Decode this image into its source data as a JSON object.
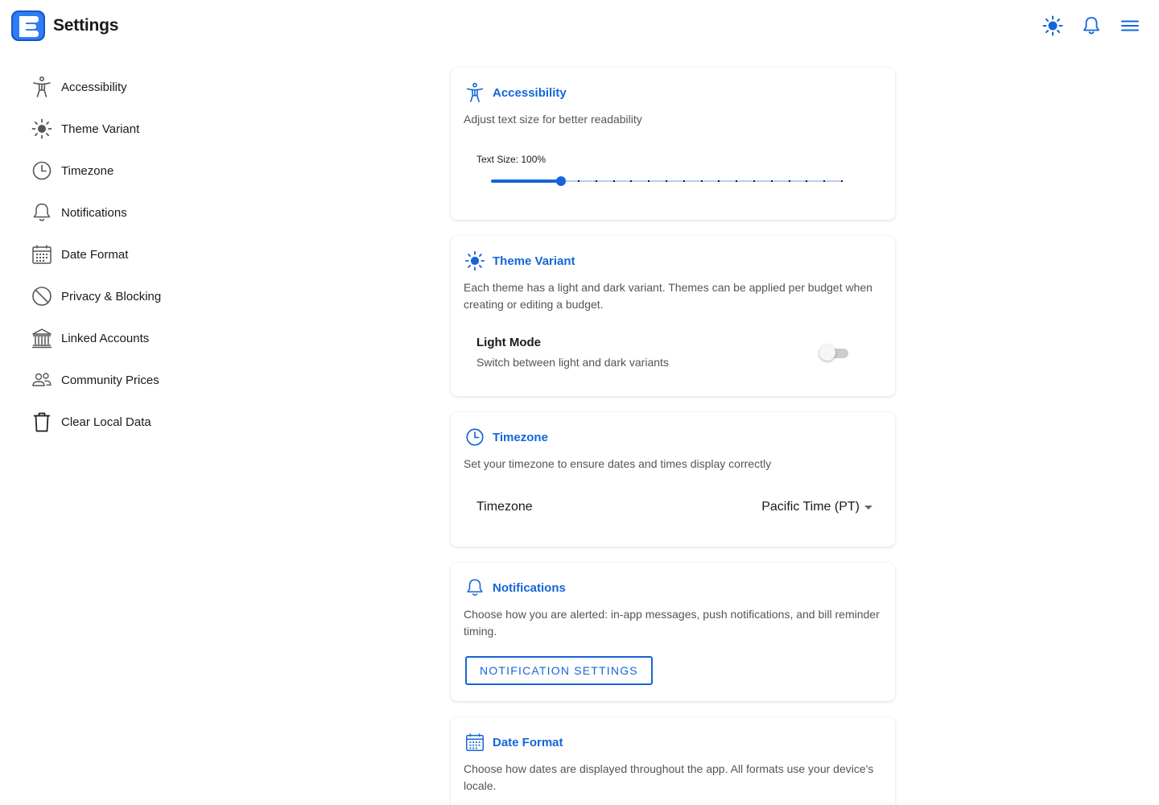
{
  "header": {
    "title": "Settings",
    "logo_letter": "E",
    "icons": [
      "sun-icon",
      "bell-icon",
      "menu-icon"
    ],
    "accent": "#1565d8"
  },
  "sidebar": {
    "items": [
      {
        "label": "Accessibility",
        "icon": "accessibility-icon"
      },
      {
        "label": "Theme Variant",
        "icon": "sun-icon"
      },
      {
        "label": "Timezone",
        "icon": "clock-icon"
      },
      {
        "label": "Notifications",
        "icon": "bell-icon"
      },
      {
        "label": "Date Format",
        "icon": "calendar-icon"
      },
      {
        "label": "Privacy & Blocking",
        "icon": "block-icon"
      },
      {
        "label": "Linked Accounts",
        "icon": "bank-icon"
      },
      {
        "label": "Community Prices",
        "icon": "people-icon"
      },
      {
        "label": "Clear Local Data",
        "icon": "trash-icon"
      }
    ]
  },
  "cards": {
    "accessibility": {
      "title": "Accessibility",
      "description": "Adjust text size for better readability",
      "slider_label": "Text Size: 100%",
      "slider_value": 100,
      "slider_min": 50,
      "slider_max": 300,
      "slider_step": 12.5
    },
    "theme": {
      "title": "Theme Variant",
      "description": "Each theme has a light and dark variant. Themes can be applied per budget when creating or editing a budget.",
      "toggle_title": "Light Mode",
      "toggle_subtitle": "Switch between light and dark variants",
      "toggle_on": false
    },
    "timezone": {
      "title": "Timezone",
      "description": "Set your timezone to ensure dates and times display correctly",
      "select_label": "Timezone",
      "select_value": "Pacific Time (PT)"
    },
    "notifications": {
      "title": "Notifications",
      "description": "Choose how you are alerted: in-app messages, push notifications, and bill reminder timing.",
      "button_label": "NOTIFICATION SETTINGS"
    },
    "date_format": {
      "title": "Date Format",
      "description": "Choose how dates are displayed throughout the app. All formats use your device's locale."
    }
  }
}
